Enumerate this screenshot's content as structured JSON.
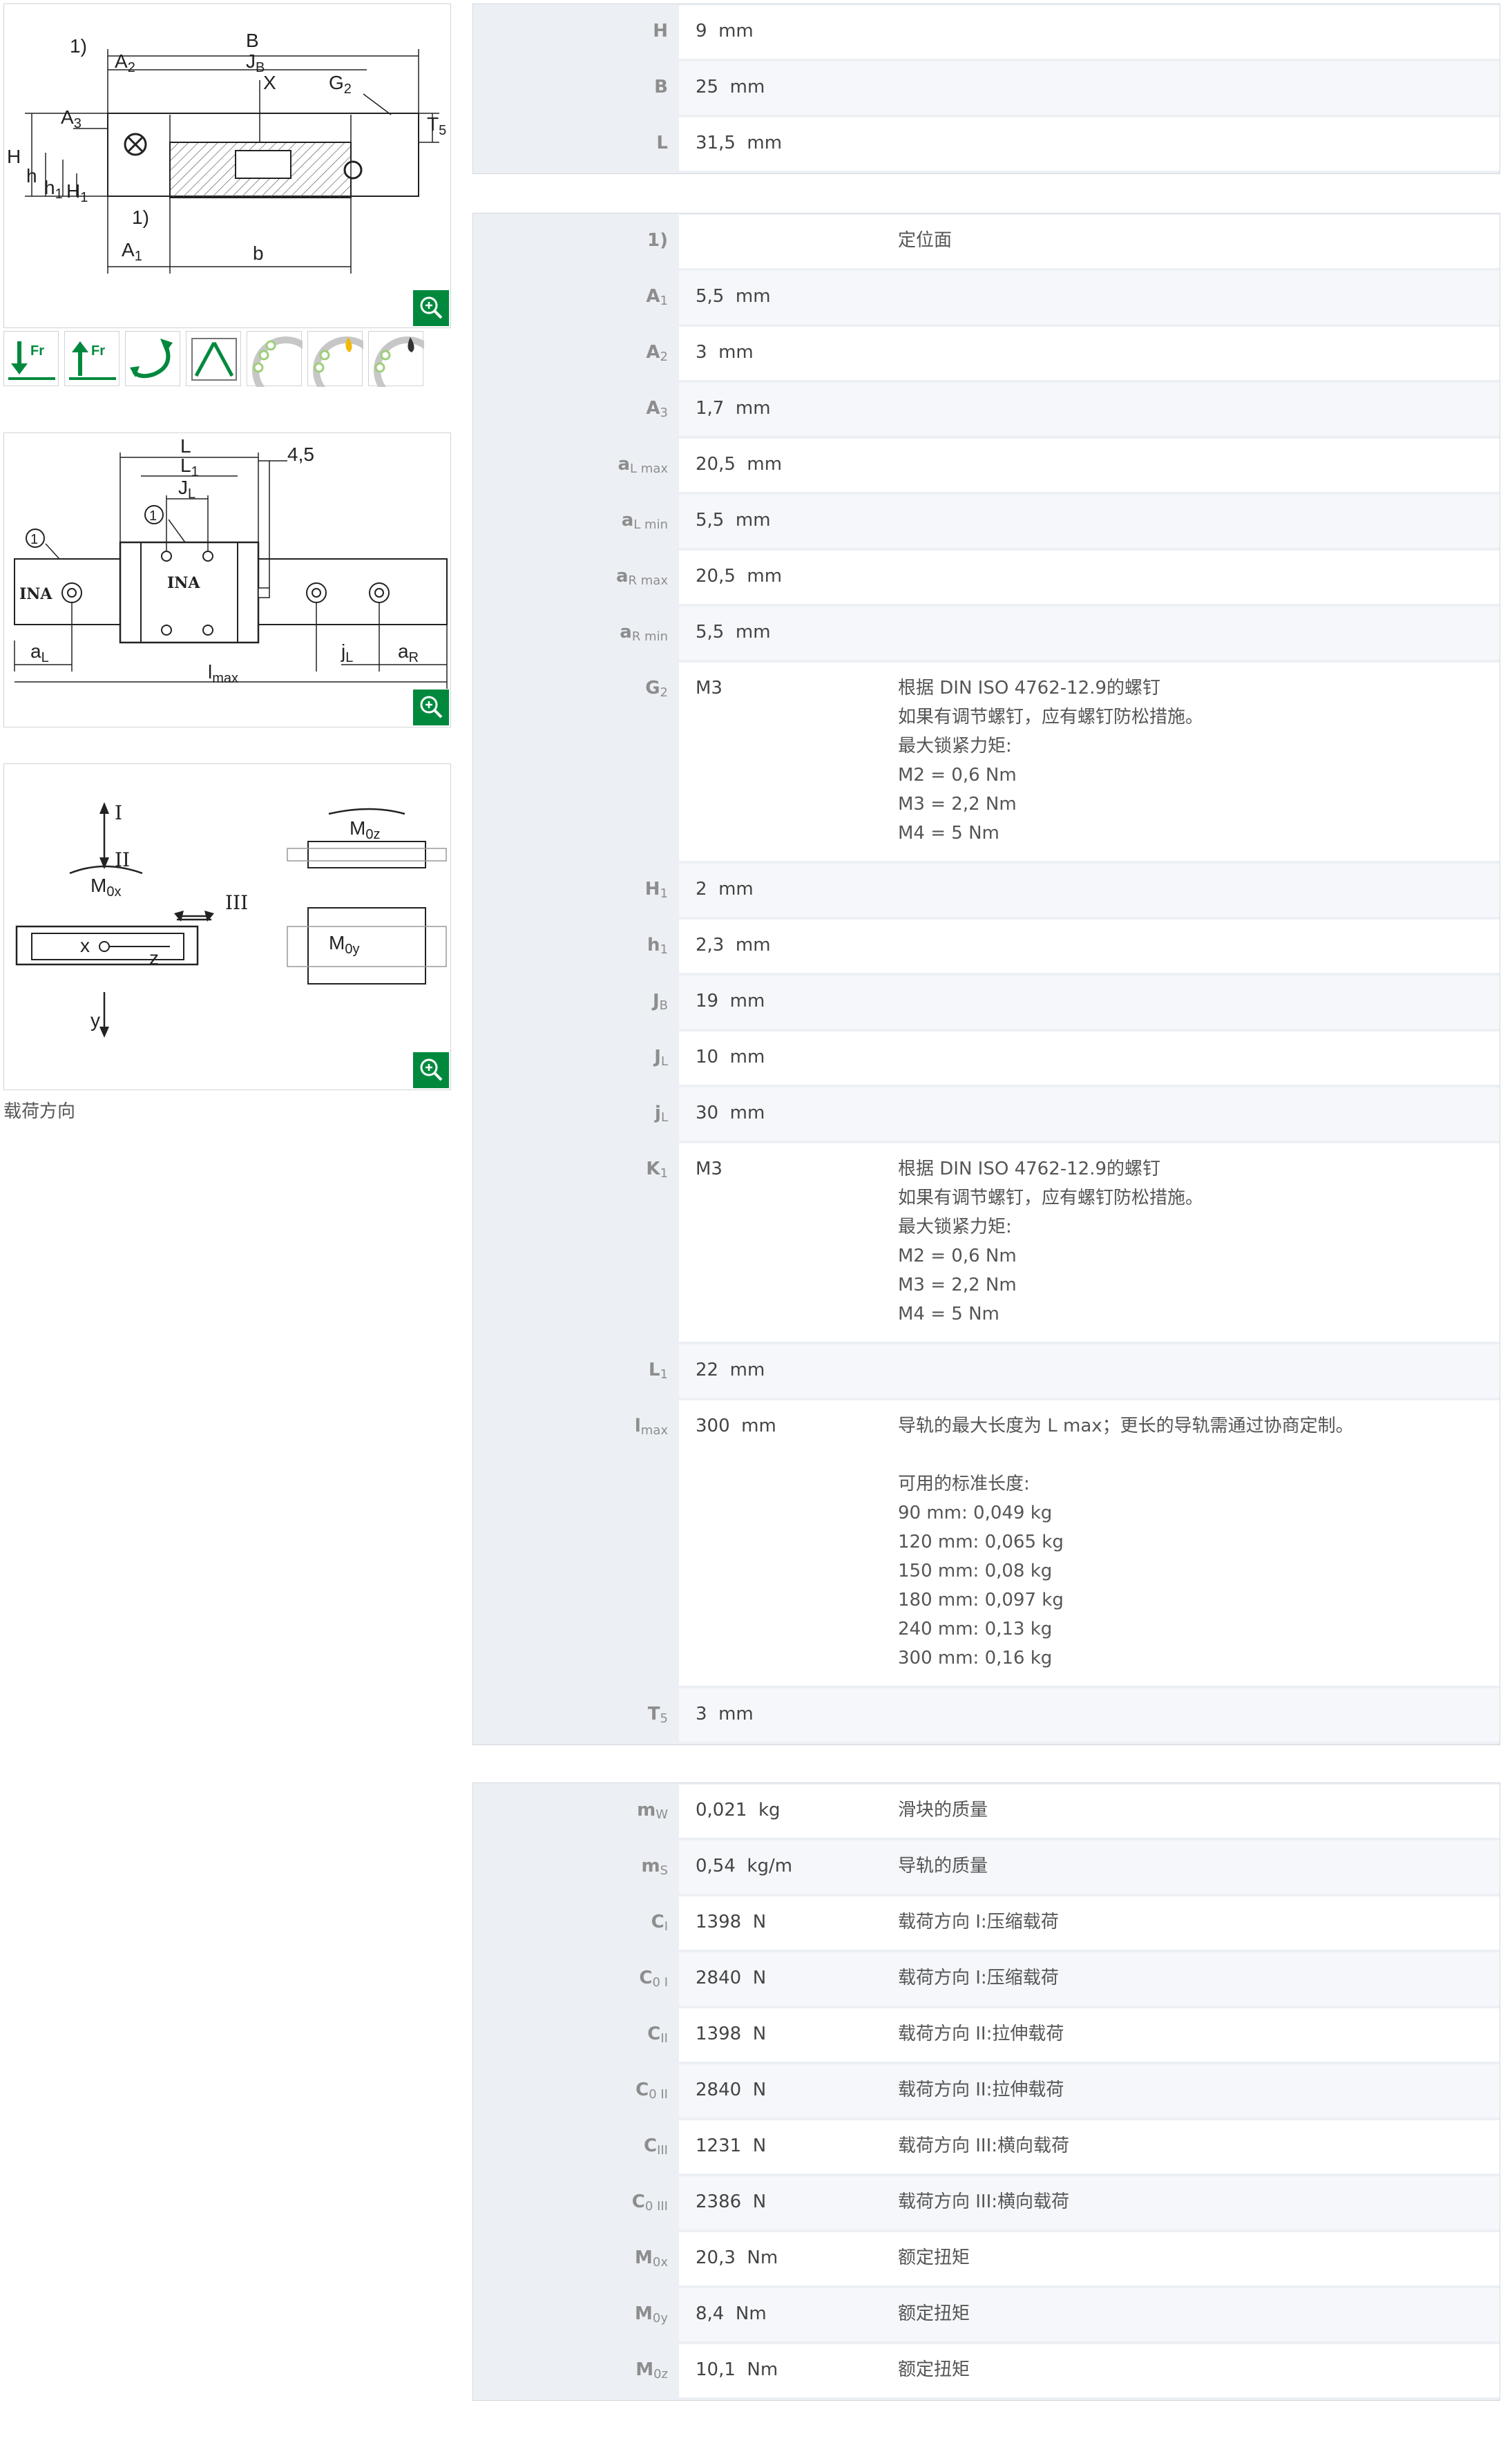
{
  "figure1": {
    "labels": {
      "B": "B",
      "one_top": "1)",
      "A2": "A",
      "A2s": "2",
      "JB": "J",
      "JBs": "B",
      "X": "X",
      "G2": "G",
      "G2s": "2",
      "A3": "A",
      "A3s": "3",
      "T5": "T",
      "T5s": "5",
      "H": "H",
      "h": "h",
      "h1": "h",
      "h1s": "1",
      "H1": "H",
      "H1s": "1",
      "one_bot": "1)",
      "A1": "A",
      "A1s": "1",
      "b": "b"
    }
  },
  "figure2": {
    "labels": {
      "L": "L",
      "L1": "L",
      "L1s": "1",
      "JL": "J",
      "JLs": "L",
      "d45": "4,5",
      "one_a": "1",
      "one_b": "1",
      "ina_rail": "INA",
      "ina_block": "INA",
      "aL": "a",
      "aLs": "L",
      "lmax": "l",
      "lmaxs": "max",
      "jL": "j",
      "jLs": "L",
      "aR": "a",
      "aRs": "R"
    }
  },
  "figure3": {
    "labels": {
      "I": "I",
      "II": "II",
      "M0x": "M",
      "M0xs": "0x",
      "III": "III",
      "x": "x",
      "z": "z",
      "y": "y",
      "M0z": "M",
      "M0zs": "0z",
      "M0y": "M",
      "M0ys": "0y"
    }
  },
  "caption": "载荷方向",
  "icons": [
    "radial-load-down-icon",
    "radial-load-up-icon",
    "rotation-icon",
    "tilting-moment-icon",
    "bearing-icon",
    "bearing-heat-icon",
    "bearing-lubrication-icon"
  ],
  "colors": {
    "accent": "#00893d",
    "label": "#8d8d8d",
    "table_bg": "#ecf0f4"
  },
  "table1": [
    {
      "label": "H",
      "sub": "",
      "value": "9  mm",
      "desc": ""
    },
    {
      "label": "B",
      "sub": "",
      "value": "25  mm",
      "desc": ""
    },
    {
      "label": "L",
      "sub": "",
      "value": "31,5  mm",
      "desc": ""
    }
  ],
  "table2": [
    {
      "label": "1)",
      "sub": "",
      "value": "",
      "desc": "定位面"
    },
    {
      "label": "A",
      "sub": "1",
      "value": "5,5  mm",
      "desc": ""
    },
    {
      "label": "A",
      "sub": "2",
      "value": "3  mm",
      "desc": ""
    },
    {
      "label": "A",
      "sub": "3",
      "value": "1,7  mm",
      "desc": ""
    },
    {
      "label": "a",
      "sub": "L max",
      "value": "20,5  mm",
      "desc": ""
    },
    {
      "label": "a",
      "sub": "L min",
      "value": "5,5  mm",
      "desc": ""
    },
    {
      "label": "a",
      "sub": "R max",
      "value": "20,5  mm",
      "desc": ""
    },
    {
      "label": "a",
      "sub": "R min",
      "value": "5,5  mm",
      "desc": ""
    },
    {
      "label": "G",
      "sub": "2",
      "value": "M3",
      "desc": "根据 DIN ISO 4762-12.9的螺钉\n如果有调节螺钉，应有螺钉防松措施。\n最大锁紧力矩:\nM2 = 0,6 Nm\nM3 = 2,2 Nm\nM4 = 5 Nm"
    },
    {
      "label": "H",
      "sub": "1",
      "value": "2  mm",
      "desc": ""
    },
    {
      "label": "h",
      "sub": "1",
      "value": "2,3  mm",
      "desc": ""
    },
    {
      "label": "J",
      "sub": "B",
      "value": "19  mm",
      "desc": ""
    },
    {
      "label": "J",
      "sub": "L",
      "value": "10  mm",
      "desc": ""
    },
    {
      "label": "j",
      "sub": "L",
      "value": "30  mm",
      "desc": ""
    },
    {
      "label": "K",
      "sub": "1",
      "value": "M3",
      "desc": "根据 DIN ISO 4762-12.9的螺钉\n如果有调节螺钉，应有螺钉防松措施。\n最大锁紧力矩:\nM2 = 0,6 Nm\nM3 = 2,2 Nm\nM4 = 5 Nm"
    },
    {
      "label": "L",
      "sub": "1",
      "value": "22  mm",
      "desc": ""
    },
    {
      "label": "l",
      "sub": "max",
      "value": "300  mm",
      "desc": "导轨的最大长度为 L max；更长的导轨需通过协商定制。\n\n可用的标准长度:\n90 mm: 0,049 kg\n120 mm: 0,065 kg\n150 mm: 0,08 kg\n180 mm: 0,097 kg\n240 mm: 0,13 kg\n300 mm: 0,16 kg"
    },
    {
      "label": "T",
      "sub": "5",
      "value": "3  mm",
      "desc": ""
    }
  ],
  "table3": [
    {
      "label": "m",
      "sub": "W",
      "value": "0,021  kg",
      "desc": "滑块的质量"
    },
    {
      "label": "m",
      "sub": "S",
      "value": "0,54  kg/m",
      "desc": "导轨的质量"
    },
    {
      "label": "C",
      "sub": "I",
      "value": "1398  N",
      "desc": "载荷方向 I:压缩载荷"
    },
    {
      "label": "C",
      "sub": "0 I",
      "value": "2840  N",
      "desc": "载荷方向 I:压缩载荷"
    },
    {
      "label": "C",
      "sub": "II",
      "value": "1398  N",
      "desc": "载荷方向 II:拉伸载荷"
    },
    {
      "label": "C",
      "sub": "0 II",
      "value": "2840  N",
      "desc": "载荷方向 II:拉伸载荷"
    },
    {
      "label": "C",
      "sub": "III",
      "value": "1231  N",
      "desc": "载荷方向 III:横向载荷"
    },
    {
      "label": "C",
      "sub": "0 III",
      "value": "2386  N",
      "desc": "载荷方向 III:横向载荷"
    },
    {
      "label": "M",
      "sub": "0x",
      "value": "20,3  Nm",
      "desc": "额定扭矩"
    },
    {
      "label": "M",
      "sub": "0y",
      "value": "8,4  Nm",
      "desc": "额定扭矩"
    },
    {
      "label": "M",
      "sub": "0z",
      "value": "10,1  Nm",
      "desc": "额定扭矩"
    }
  ]
}
